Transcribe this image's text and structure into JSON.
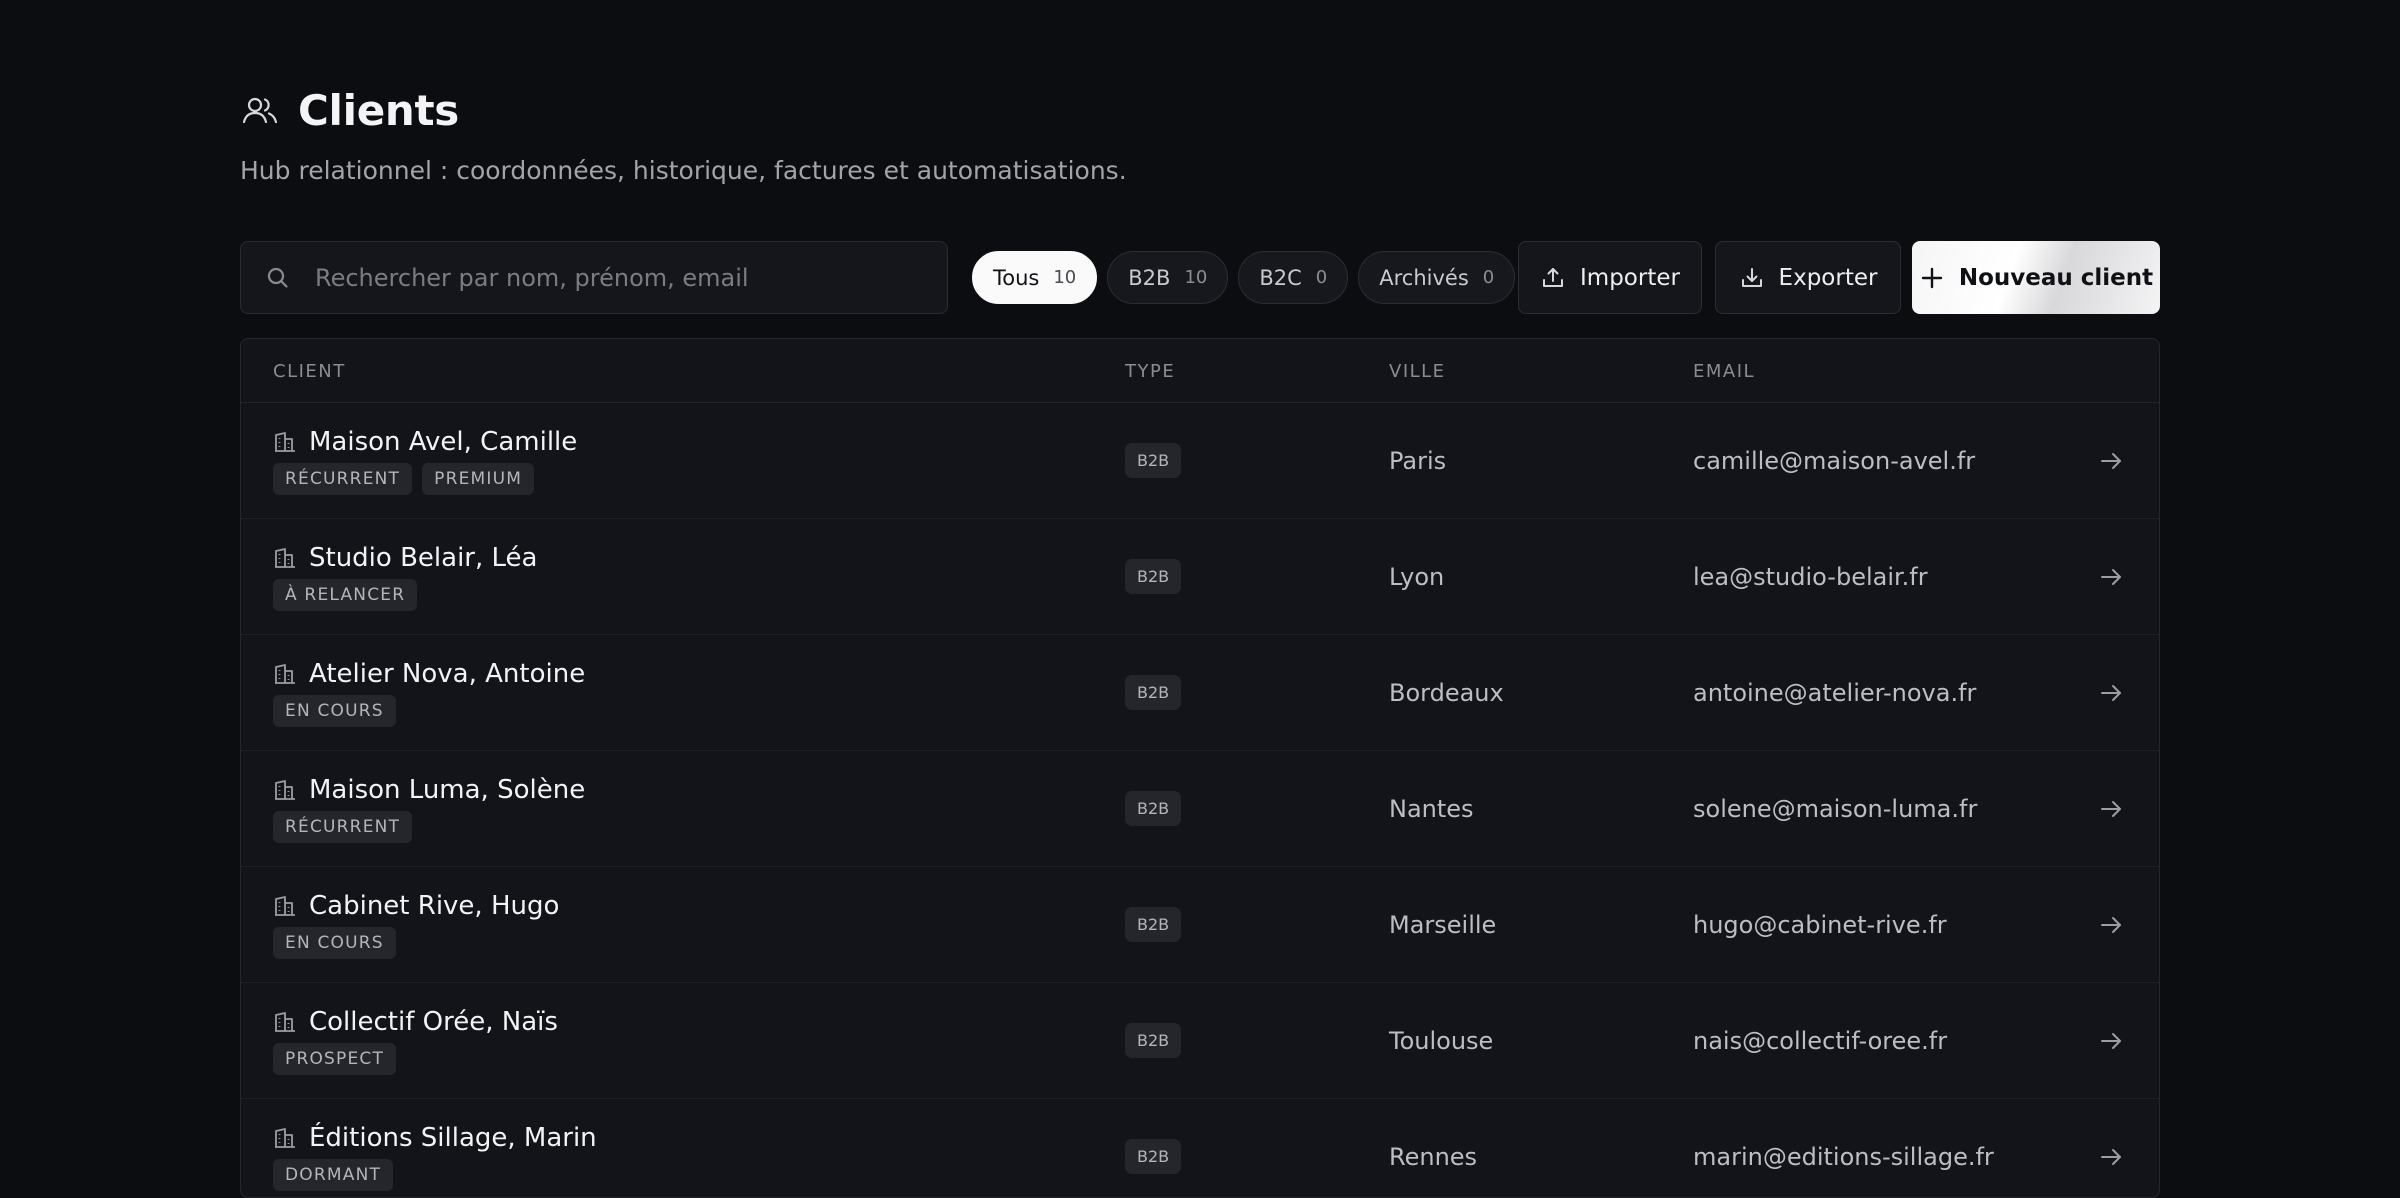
{
  "header": {
    "title": "Clients",
    "subtitle": "Hub relationnel : coordonnées, historique, factures et automatisations.",
    "icon": "users-icon"
  },
  "search": {
    "placeholder": "Rechercher par nom, prénom, email",
    "value": ""
  },
  "filters": [
    {
      "label": "Tous",
      "count": "10",
      "active": true
    },
    {
      "label": "B2B",
      "count": "10",
      "active": false
    },
    {
      "label": "B2C",
      "count": "0",
      "active": false
    },
    {
      "label": "Archivés",
      "count": "0",
      "active": false
    }
  ],
  "actions": {
    "import_label": "Importer",
    "export_label": "Exporter",
    "new_label": "Nouveau client"
  },
  "table": {
    "columns": [
      "CLIENT",
      "TYPE",
      "VILLE",
      "EMAIL"
    ],
    "rows": [
      {
        "name": "Maison Avel, Camille",
        "tags": [
          "RÉCURRENT",
          "PREMIUM"
        ],
        "type": "B2B",
        "city": "Paris",
        "email": "camille@maison-avel.fr"
      },
      {
        "name": "Studio Belair, Léa",
        "tags": [
          "À RELANCER"
        ],
        "type": "B2B",
        "city": "Lyon",
        "email": "lea@studio-belair.fr"
      },
      {
        "name": "Atelier Nova, Antoine",
        "tags": [
          "EN COURS"
        ],
        "type": "B2B",
        "city": "Bordeaux",
        "email": "antoine@atelier-nova.fr"
      },
      {
        "name": "Maison Luma, Solène",
        "tags": [
          "RÉCURRENT"
        ],
        "type": "B2B",
        "city": "Nantes",
        "email": "solene@maison-luma.fr"
      },
      {
        "name": "Cabinet Rive, Hugo",
        "tags": [
          "EN COURS"
        ],
        "type": "B2B",
        "city": "Marseille",
        "email": "hugo@cabinet-rive.fr"
      },
      {
        "name": "Collectif Orée, Naïs",
        "tags": [
          "PROSPECT"
        ],
        "type": "B2B",
        "city": "Toulouse",
        "email": "nais@collectif-oree.fr"
      },
      {
        "name": "Éditions Sillage, Marin",
        "tags": [
          "DORMANT"
        ],
        "type": "B2B",
        "city": "Rennes",
        "email": "marin@editions-sillage.fr"
      }
    ]
  }
}
